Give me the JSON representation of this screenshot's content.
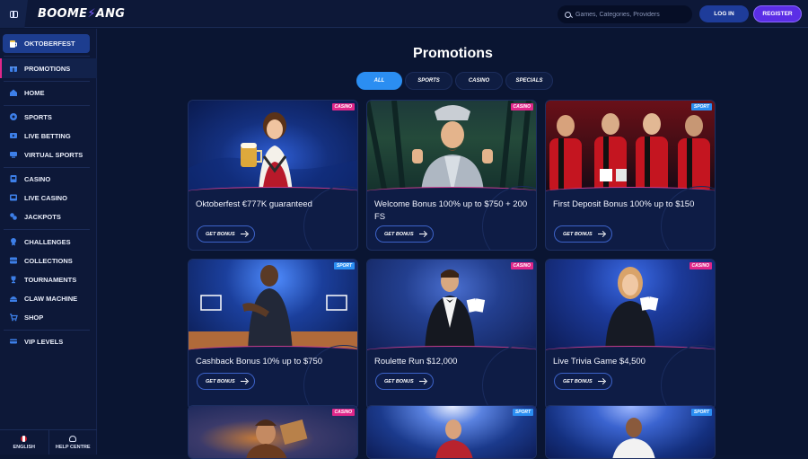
{
  "header": {
    "logo_text": "BOOMERANG",
    "search_placeholder": "Games, Categories, Providers",
    "login_label": "LOG IN",
    "register_label": "REGISTER"
  },
  "sidebar": {
    "featured": "OKTOBERFEST",
    "promotions": "PROMOTIONS",
    "items": [
      {
        "label": "HOME",
        "icon": "home-icon"
      },
      {
        "label": "SPORTS",
        "icon": "soccer-ball-icon"
      },
      {
        "label": "LIVE BETTING",
        "icon": "live-betting-icon"
      },
      {
        "label": "VIRTUAL SPORTS",
        "icon": "virtual-sports-icon"
      },
      {
        "label": "CASINO",
        "icon": "slot-icon"
      },
      {
        "label": "LIVE CASINO",
        "icon": "live-casino-icon"
      },
      {
        "label": "JACKPOTS",
        "icon": "jackpot-icon"
      },
      {
        "label": "CHALLENGES",
        "icon": "challenges-icon"
      },
      {
        "label": "COLLECTIONS",
        "icon": "collections-icon"
      },
      {
        "label": "TOURNAMENTS",
        "icon": "trophy-icon"
      },
      {
        "label": "CLAW MACHINE",
        "icon": "claw-machine-icon"
      },
      {
        "label": "SHOP",
        "icon": "shop-icon"
      },
      {
        "label": "VIP LEVELS",
        "icon": "vip-icon"
      }
    ],
    "language": "ENGLISH",
    "help": "HELP CENTRE"
  },
  "main": {
    "title": "Promotions",
    "filters": [
      "ALL",
      "SPORTS",
      "CASINO",
      "SPECIALS"
    ],
    "active_filter": "ALL",
    "cta_label": "GET BONUS",
    "cards": [
      {
        "title": "Oktoberfest €777K guaranteed",
        "tag": "CASINO"
      },
      {
        "title": "Welcome Bonus 100% up to $750 + 200 FS",
        "tag": "CASINO"
      },
      {
        "title": "First Deposit Bonus 100% up to $150",
        "tag": "SPORT"
      },
      {
        "title": "Cashback Bonus 10% up to $750",
        "tag": "SPORT"
      },
      {
        "title": "Roulette Run $12,000",
        "tag": "CASINO"
      },
      {
        "title": "Live Trivia Game $4,500",
        "tag": "CASINO"
      },
      {
        "title": "",
        "tag": "CASINO"
      },
      {
        "title": "",
        "tag": "SPORT"
      },
      {
        "title": "",
        "tag": "SPORT"
      }
    ]
  },
  "colors": {
    "background": "#0b1633",
    "accent_blue": "#2b8ef2",
    "casino_tag": "#e0278a",
    "register": "#5b2ee6"
  }
}
